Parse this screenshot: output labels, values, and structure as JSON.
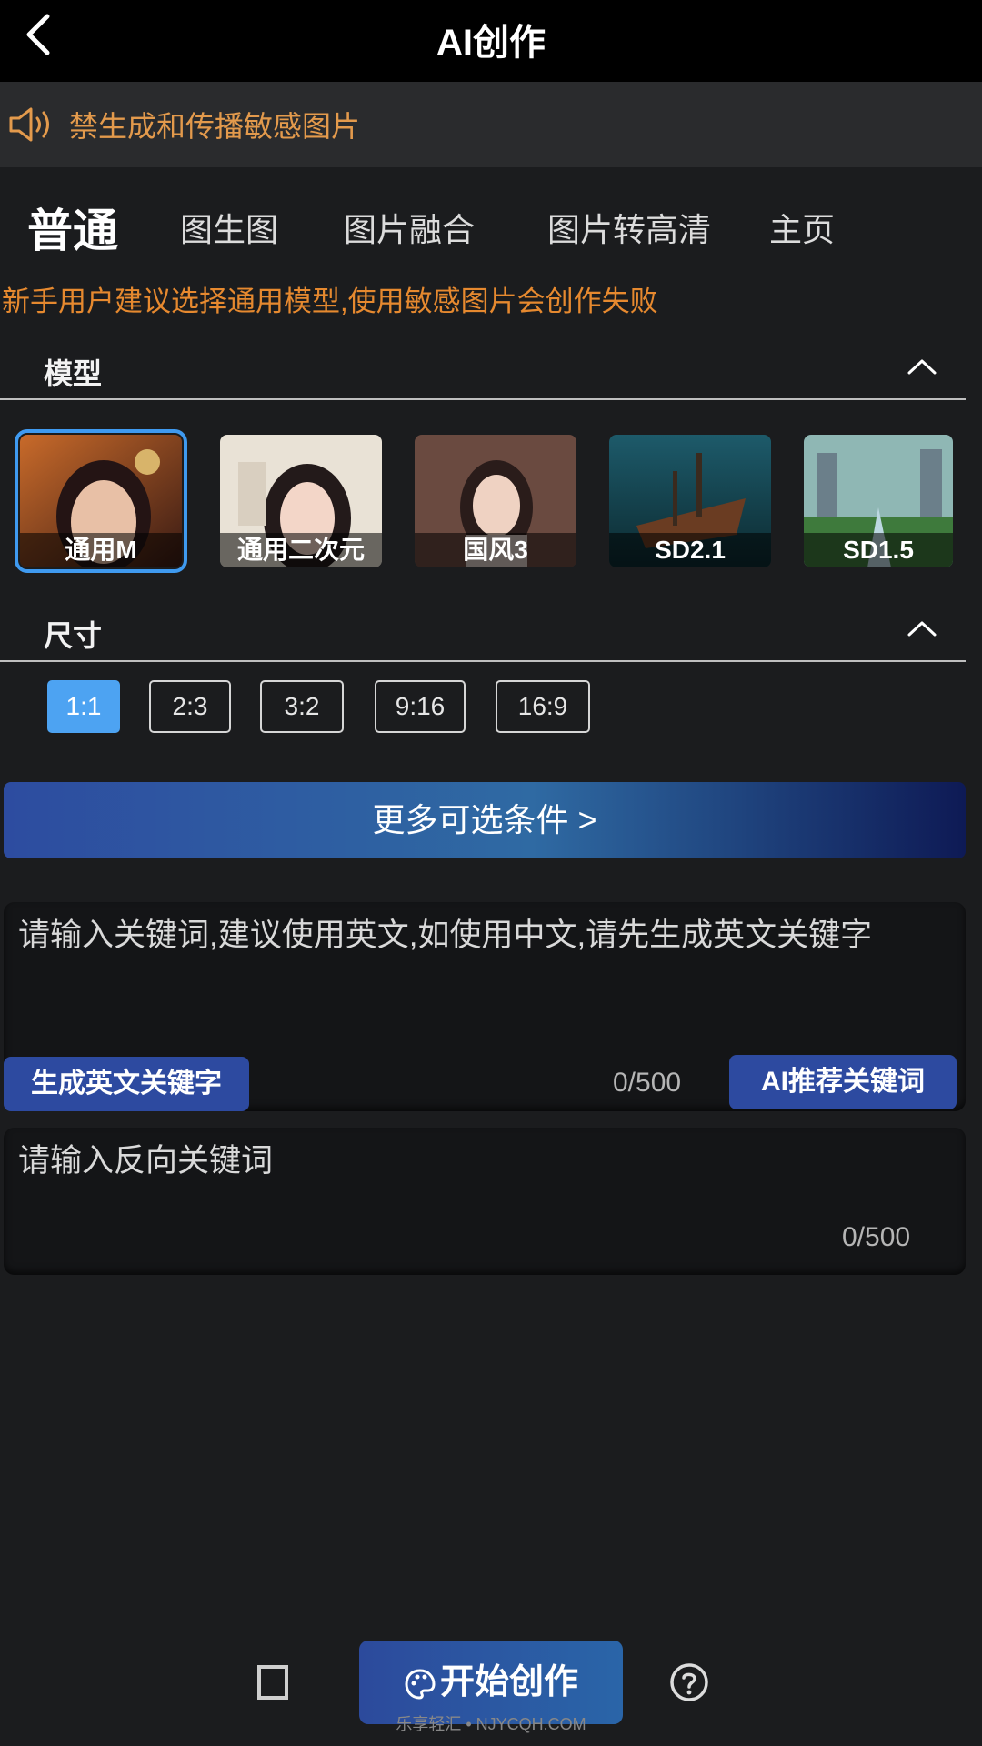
{
  "header": {
    "title": "AI创作"
  },
  "notice": {
    "text": "禁生成和传播敏感图片"
  },
  "tabs": [
    {
      "label": "普通",
      "active": true
    },
    {
      "label": "图生图"
    },
    {
      "label": "图片融合"
    },
    {
      "label": "图片转高清"
    },
    {
      "label": "主页"
    }
  ],
  "warning": "新手用户建议选择通用模型,使用敏感图片会创作失败",
  "model_section": {
    "title": "模型"
  },
  "models": [
    {
      "label": "通用M",
      "selected": true
    },
    {
      "label": "通用二次元"
    },
    {
      "label": "国风3"
    },
    {
      "label": "SD2.1"
    },
    {
      "label": "SD1.5"
    }
  ],
  "size_section": {
    "title": "尺寸"
  },
  "sizes": [
    {
      "label": "1:1",
      "selected": true
    },
    {
      "label": "2:3"
    },
    {
      "label": "3:2"
    },
    {
      "label": "9:16"
    },
    {
      "label": "16:9"
    }
  ],
  "more_options": "更多可选条件 >",
  "prompt": {
    "placeholder": "请输入关键词,建议使用英文,如使用中文,请先生成英文关键字",
    "count": "0/500",
    "generate_en_button": "生成英文关键字",
    "ai_recommend_button": "AI推荐关键词"
  },
  "negative_prompt": {
    "placeholder": "请输入反向关键词",
    "count": "0/500"
  },
  "bottom": {
    "start_button": "开始创作"
  },
  "watermark": "乐享轻汇 • NJYCQH.COM",
  "colors": {
    "accent": "#4da3f2",
    "warning": "#e6892f",
    "notice": "#e39a4c"
  }
}
